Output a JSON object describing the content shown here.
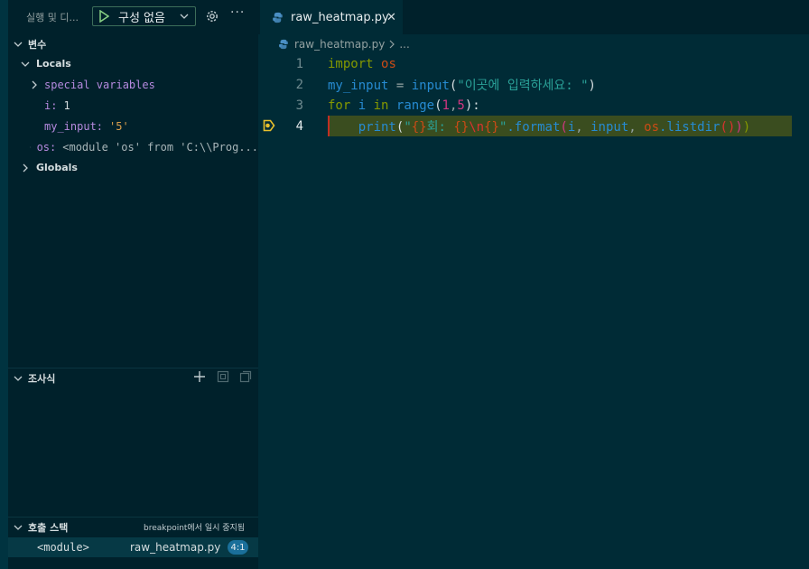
{
  "sidebar": {
    "title": "실행 및 디...",
    "run_config": "구성 없음",
    "variables_header": "변수",
    "locals_label": "Locals",
    "variables": [
      {
        "name": "special variables",
        "value": ""
      },
      {
        "name": "i:",
        "value": "1"
      },
      {
        "name": "my_input:",
        "value": "'5'"
      },
      {
        "name": "os:",
        "value": "<module 'os' from 'C:\\\\Prog..."
      }
    ],
    "globals_label": "Globals",
    "watch_header": "조사식",
    "callstack_header": "호출 스택",
    "callstack_status": "breakpoint에서 일시 중지됨",
    "callstack_frame": {
      "name": "<module>",
      "file": "raw_heatmap.py",
      "position": "4:1"
    }
  },
  "editor": {
    "tab_label": "raw_heatmap.py",
    "breadcrumb_file": "raw_heatmap.py",
    "breadcrumb_more": "...",
    "lines": [
      {
        "num": "1",
        "tokens": {
          "t1": "import",
          "t2": " ",
          "t3": "os"
        }
      },
      {
        "num": "2",
        "tokens": {
          "t1": "my_input",
          "t2": " = ",
          "t3": "input",
          "t4": "(",
          "t5": "\"이곳에 입력하세요: \"",
          "t6": ")"
        }
      },
      {
        "num": "3",
        "tokens": {
          "t1": "for",
          "t2": " ",
          "t3": "i",
          "t4": " ",
          "t5": "in",
          "t6": " ",
          "t7": "range",
          "t8": "(",
          "t9": "1",
          "t10": ",",
          "t11": "5",
          "t12": "):"
        }
      },
      {
        "num": "4",
        "tokens": {
          "t0": "    ",
          "t1": "print",
          "t2": "(",
          "t3": "\"",
          "t4": "{}",
          "t5": "회: ",
          "t6": "{}",
          "t7": "\\n",
          "t8": "{}",
          "t9": "\"",
          "t10": ".format",
          "t11": "(",
          "t12": "i",
          "t13": ", ",
          "t14": "input",
          "t15": ", ",
          "t16": "os",
          "t17": ".listdir",
          "t18": "()",
          "t19": ")",
          "t20": ")"
        }
      }
    ]
  },
  "colors": {
    "accent": "#268bd2",
    "breakpoint": "#e8c02c",
    "current_line": "#3a4d1f"
  }
}
